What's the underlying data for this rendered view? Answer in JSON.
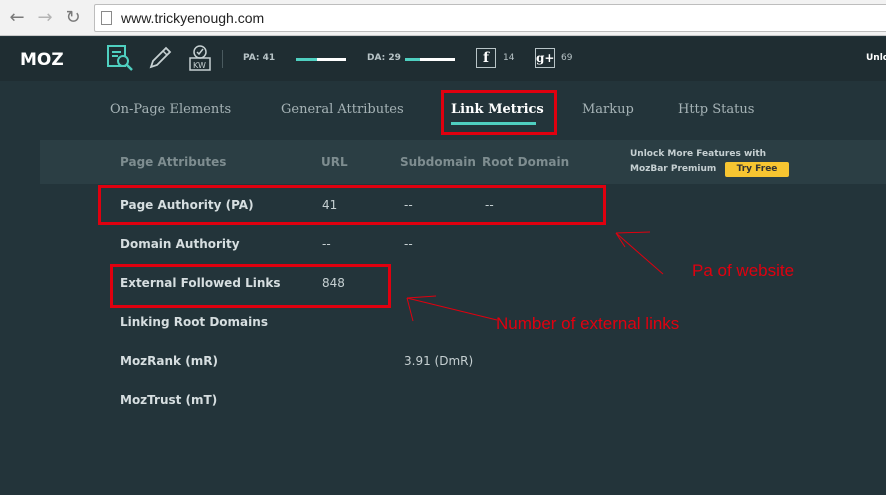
{
  "browser": {
    "url": "www.trickyenough.com"
  },
  "mozbar": {
    "logo": "MOZ",
    "pa_label": "PA: 41",
    "pa_value": 41,
    "da_label": "DA: 29",
    "da_value": 29,
    "facebook_glyph": "f",
    "facebook_count": "14",
    "gplus_glyph": "g+",
    "gplus_count": "69",
    "unlock_text": "Unlo",
    "accent": "#4fcfc0"
  },
  "tabs": [
    {
      "label": "On-Page Elements",
      "active": false
    },
    {
      "label": "General Attributes",
      "active": false
    },
    {
      "label": "Link Metrics",
      "active": true
    },
    {
      "label": "Markup",
      "active": false
    },
    {
      "label": "Http Status",
      "active": false
    }
  ],
  "table": {
    "headers": [
      "Page Attributes",
      "URL",
      "Subdomain",
      "Root Domain"
    ],
    "unlock_line1": "Unlock More Features with",
    "unlock_line2": "MozBar Premium",
    "try_free": "Try Free",
    "rows": [
      {
        "label": "Page Authority (PA)",
        "url": "41",
        "subdomain": "--",
        "root": "--"
      },
      {
        "label": "Domain Authority",
        "url": "--",
        "subdomain": "--",
        "root": ""
      },
      {
        "label": "External Followed Links",
        "url": "848",
        "subdomain": "",
        "root": ""
      },
      {
        "label": "Linking Root Domains",
        "url": "",
        "subdomain": "",
        "root": ""
      },
      {
        "label": "MozRank (mR)",
        "url": "",
        "subdomain": "3.91 (DmR)",
        "root": ""
      },
      {
        "label": "MozTrust (mT)",
        "url": "",
        "subdomain": "",
        "root": ""
      }
    ]
  },
  "annotations": {
    "pa_note": "Pa of website",
    "links_note": "Number of external links",
    "color": "#e0000f"
  }
}
